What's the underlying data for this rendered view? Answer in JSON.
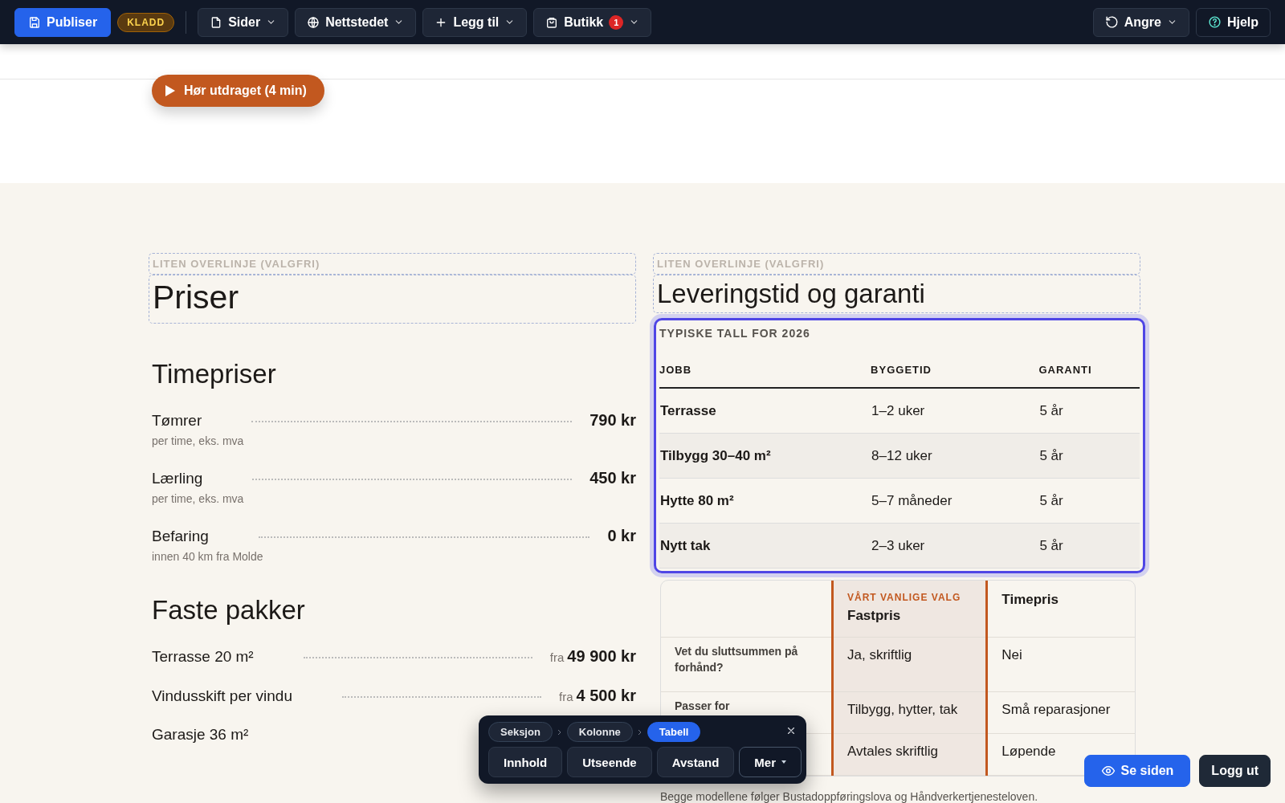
{
  "topbar": {
    "publish_button": "Publiser",
    "status_badge": "KLADD",
    "menus": [
      {
        "label": "Sider"
      },
      {
        "label": "Nettstedet"
      },
      {
        "label": "Legg til"
      },
      {
        "label": "Butikk",
        "badge": "1"
      }
    ],
    "right_buttons": [
      {
        "label": "Angre",
        "dropdown": true
      },
      {
        "label": "Hjelp",
        "dropdown": false
      }
    ]
  },
  "hero": {
    "audio_button": "Hør utdraget (4 min)"
  },
  "left": {
    "overline_placeholder": "LITEN OVERLINJE (VALGFRI)",
    "title": "Priser",
    "sections": [
      {
        "heading": "Timepriser",
        "items": [
          {
            "name": "Tømrer",
            "note": "per time, eks. mva",
            "price": "790 kr"
          },
          {
            "name": "Lærling",
            "note": "per time, eks. mva",
            "price": "450 kr"
          },
          {
            "name": "Befaring",
            "note": "innen 40 km fra Molde",
            "price": "0 kr"
          }
        ]
      },
      {
        "heading": "Faste pakker",
        "items": [
          {
            "name": "Terrasse 20 m²",
            "prefix": "fra",
            "price": "49 900 kr"
          },
          {
            "name": "Vindusskift per vindu",
            "prefix": "fra",
            "price": "4 500 kr"
          },
          {
            "name": "Garasje 36 m²"
          }
        ]
      }
    ]
  },
  "right": {
    "overline_placeholder": "LITEN OVERLINJE (VALGFRI)",
    "title": "Leveringstid og garanti",
    "spec_table": {
      "caption": "TYPISKE TALL FOR 2026",
      "columns": [
        "JOBB",
        "BYGGETID",
        "GARANTI"
      ],
      "rows": [
        [
          "Terrasse",
          "1–2 uker",
          "5 år"
        ],
        [
          "Tilbygg 30–40 m²",
          "8–12 uker",
          "5 år"
        ],
        [
          "Hytte 80 m²",
          "5–7 måneder",
          "5 år"
        ],
        [
          "Nytt tak",
          "2–3 uker",
          "5 år"
        ]
      ]
    },
    "comparison": {
      "columns": [
        {
          "eyebrow": "VÅRT VANLIGE VALG",
          "label": "Fastpris",
          "highlighted": true
        },
        {
          "label": "Timepris",
          "highlighted": false
        }
      ],
      "rows": [
        {
          "label": "Vet du sluttsummen på forhånd?",
          "values": [
            "Ja, skriftlig",
            "Nei"
          ]
        },
        {
          "label": "Passer for",
          "values": [
            "Tilbygg, hytter, tak",
            "Små reparasjoner"
          ]
        },
        {
          "values": [
            "Avtales skriftlig",
            "Løpende"
          ]
        }
      ]
    },
    "footnote": "Begge modellene følger Bustadoppføringslova og Håndverkertjenesteloven."
  },
  "editor_toolbar": {
    "breadcrumb": [
      {
        "label": "Seksjon",
        "selected": false
      },
      {
        "label": "Kolonne",
        "selected": false
      },
      {
        "label": "Tabell",
        "selected": true
      }
    ],
    "actions": [
      {
        "label": "Innhold",
        "dropdown": false
      },
      {
        "label": "Utseende",
        "dropdown": false
      },
      {
        "label": "Avstand",
        "dropdown": false
      },
      {
        "label": "Mer",
        "dropdown": true
      }
    ]
  },
  "bottom_buttons": [
    {
      "label": "Se siden",
      "kind": "primary"
    },
    {
      "label": "Logg ut",
      "kind": "dark"
    }
  ]
}
